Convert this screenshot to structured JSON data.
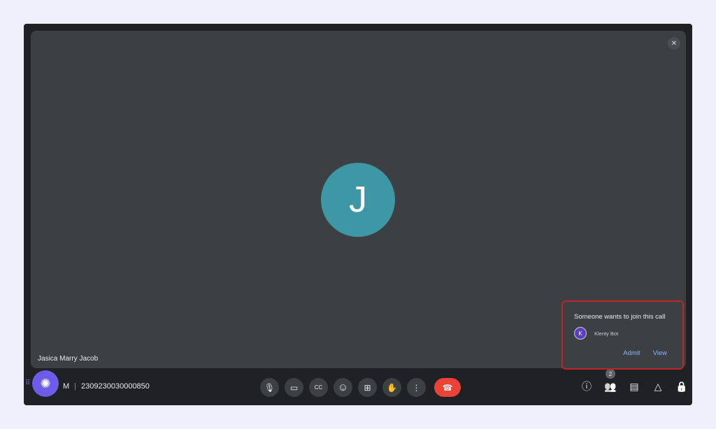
{
  "participant": {
    "name": "Jasica Marry Jacob",
    "initial": "J"
  },
  "meeting": {
    "time_fragment": "M",
    "id": "2309230030000850"
  },
  "controls": [
    {
      "name": "microphone",
      "icon": "🎙"
    },
    {
      "name": "camera",
      "icon": "▭"
    },
    {
      "name": "captions",
      "icon": "CC"
    },
    {
      "name": "emoji",
      "icon": "☺"
    },
    {
      "name": "present",
      "icon": "⊞"
    },
    {
      "name": "raise-hand",
      "icon": "✋"
    },
    {
      "name": "more-options",
      "icon": "⋮"
    },
    {
      "name": "leave-call",
      "icon": "☎"
    }
  ],
  "right_controls": {
    "info": "ⓘ",
    "people": "👥",
    "people_count": "2",
    "chat": "▤",
    "activities": "△",
    "host_controls": "🔒"
  },
  "popup": {
    "title": "Someone wants to join this call",
    "requester_initial": "K",
    "requester_name": "Klenty Bot",
    "admit": "Admit",
    "view": "View"
  },
  "colors": {
    "avatar": "#3e97a5",
    "end_call": "#ea4335",
    "link": "#8ab4f8",
    "highlight": "#c0242b"
  }
}
